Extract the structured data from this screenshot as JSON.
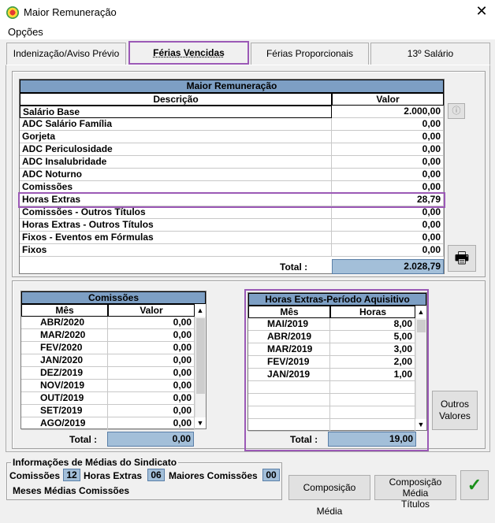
{
  "window": {
    "title": "Maior Remuneração",
    "close_glyph": "✕"
  },
  "menu": {
    "items": [
      "Opções"
    ]
  },
  "tabs": [
    {
      "label": "Indenização/Aviso Prévio"
    },
    {
      "label": "Férias Vencidas"
    },
    {
      "label": "Férias Proporcionais"
    },
    {
      "label": "13º Salário"
    }
  ],
  "main_grid": {
    "title": "Maior Remuneração",
    "col_desc": "Descrição",
    "col_val": "Valor",
    "rows": [
      {
        "desc": "Salário Base",
        "val": "2.000,00"
      },
      {
        "desc": "ADC Salário Família",
        "val": "0,00"
      },
      {
        "desc": "Gorjeta",
        "val": "0,00"
      },
      {
        "desc": "ADC Periculosidade",
        "val": "0,00"
      },
      {
        "desc": "ADC Insalubridade",
        "val": "0,00"
      },
      {
        "desc": "ADC Noturno",
        "val": "0,00"
      },
      {
        "desc": "Comissões",
        "val": "0,00"
      },
      {
        "desc": "Horas Extras",
        "val": "28,79"
      },
      {
        "desc": "Comissões - Outros Títulos",
        "val": "0,00"
      },
      {
        "desc": "Horas Extras - Outros Títulos",
        "val": "0,00"
      },
      {
        "desc": "Fixos - Eventos em Fórmulas",
        "val": "0,00"
      },
      {
        "desc": "Fixos",
        "val": "0,00"
      }
    ],
    "total_label": "Total :",
    "total_value": "2.028,79"
  },
  "comissoes": {
    "title": "Comissões",
    "col_mes": "Mês",
    "col_val": "Valor",
    "rows": [
      {
        "mes": "ABR/2020",
        "val": "0,00"
      },
      {
        "mes": "MAR/2020",
        "val": "0,00"
      },
      {
        "mes": "FEV/2020",
        "val": "0,00"
      },
      {
        "mes": "JAN/2020",
        "val": "0,00"
      },
      {
        "mes": "DEZ/2019",
        "val": "0,00"
      },
      {
        "mes": "NOV/2019",
        "val": "0,00"
      },
      {
        "mes": "OUT/2019",
        "val": "0,00"
      },
      {
        "mes": "SET/2019",
        "val": "0,00"
      },
      {
        "mes": "AGO/2019",
        "val": "0,00"
      }
    ],
    "total_label": "Total :",
    "total_value": "0,00"
  },
  "horas_extras": {
    "title": "Horas Extras-Período Aquisitivo",
    "col_mes": "Mês",
    "col_horas": "Horas",
    "rows": [
      {
        "mes": "MAI/2019",
        "val": "8,00"
      },
      {
        "mes": "ABR/2019",
        "val": "5,00"
      },
      {
        "mes": "MAR/2019",
        "val": "3,00"
      },
      {
        "mes": "FEV/2019",
        "val": "2,00"
      },
      {
        "mes": "JAN/2019",
        "val": "1,00"
      }
    ],
    "total_label": "Total :",
    "total_value": "19,00"
  },
  "buttons": {
    "outros_valores_1": "Outros",
    "outros_valores_2": "Valores",
    "composicao_media": "Composição Média",
    "composicao_titulos_1": "Composição Média",
    "composicao_titulos_2": "Títulos",
    "ok_glyph": "✓",
    "print_glyph": "🖶"
  },
  "sindicato": {
    "title": "Informações de Médias do Sindicato",
    "comissoes_label": "Comissões",
    "comissoes_value": "12",
    "horas_label": "Horas Extras",
    "horas_value": "06",
    "maiores_label": "Maiores Comissões",
    "maiores_value": "00",
    "meses_label": "Meses Médias Comissões"
  },
  "colors": {
    "header_blue": "#7d9fc4",
    "total_blue": "#a3bfd9",
    "highlight_purple": "#9b59b6",
    "ok_green": "#1a8f1a"
  }
}
